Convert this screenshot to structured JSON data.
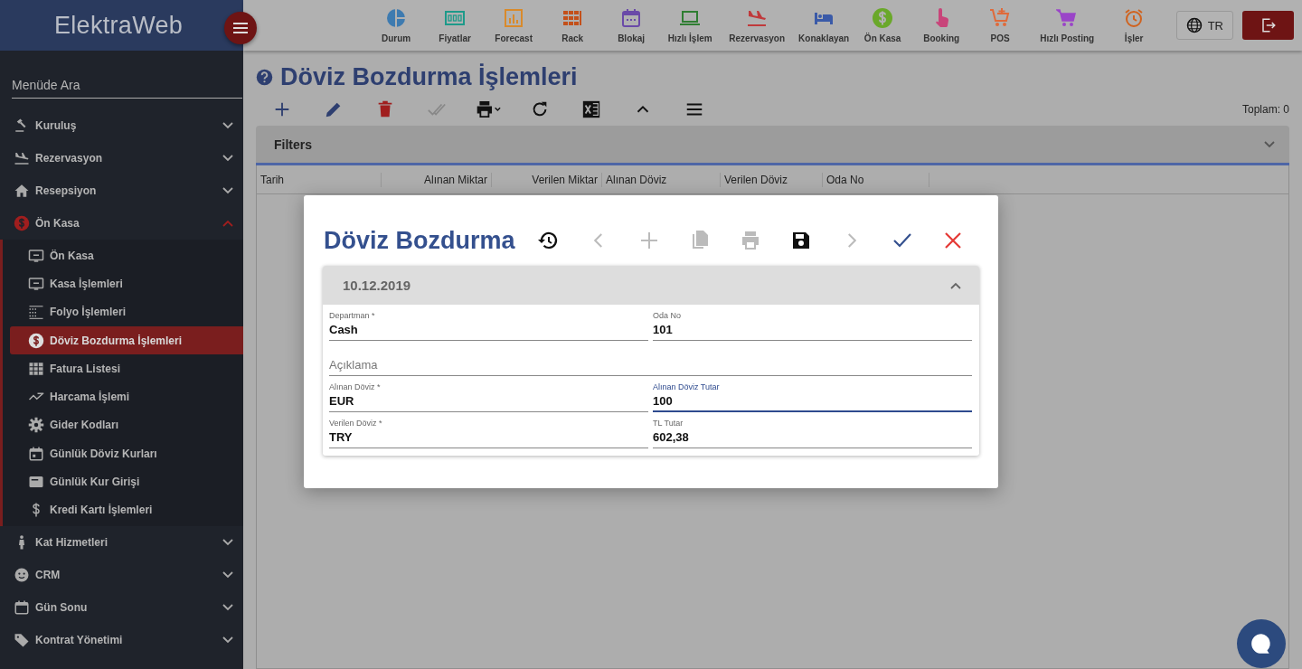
{
  "app": {
    "logo": "ElektraWeb",
    "language": "TR"
  },
  "top_nav": [
    {
      "label": "Durum",
      "color": "#3e7bb0"
    },
    {
      "label": "Fiyatlar",
      "color": "#1d9a8a"
    },
    {
      "label": "Forecast",
      "color": "#d98a2b"
    },
    {
      "label": "Rack",
      "color": "#c4501a"
    },
    {
      "label": "Blokaj",
      "color": "#6a4aa8"
    },
    {
      "label": "Hızlı İşlem",
      "color": "#2f7d32"
    },
    {
      "label": "Rezervasyon",
      "color": "#c0393b"
    },
    {
      "label": "Konaklayan",
      "color": "#3a5aa8"
    },
    {
      "label": "Ön Kasa",
      "color": "#6aa82a"
    },
    {
      "label": "Booking",
      "color": "#c8457a"
    },
    {
      "label": "POS",
      "color": "#e06a3a"
    },
    {
      "label": "Hızlı Posting",
      "color": "#9a45c8"
    },
    {
      "label": "İşler",
      "color": "#d0621e"
    }
  ],
  "sidebar": {
    "search": {
      "placeholder": "Menüde Ara"
    },
    "items": [
      {
        "label": "Kuruluş",
        "expanded": false
      },
      {
        "label": "Rezervasyon",
        "expanded": false
      },
      {
        "label": "Resepsiyon",
        "expanded": false
      },
      {
        "label": "Ön Kasa",
        "expanded": true,
        "children": [
          {
            "label": "Ön Kasa",
            "selected": false
          },
          {
            "label": "Kasa İşlemleri",
            "selected": false
          },
          {
            "label": "Folyo İşlemleri",
            "selected": false
          },
          {
            "label": "Döviz Bozdurma İşlemleri",
            "selected": true
          },
          {
            "label": "Fatura Listesi",
            "selected": false
          },
          {
            "label": "Harcama İşlemi",
            "selected": false
          },
          {
            "label": "Gider Kodları",
            "selected": false
          },
          {
            "label": "Günlük Döviz Kurları",
            "selected": false
          },
          {
            "label": "Günlük Kur Girişi",
            "selected": false
          },
          {
            "label": "Kredi Kartı İşlemleri",
            "selected": false
          }
        ]
      },
      {
        "label": "Kat Hizmetleri",
        "expanded": false
      },
      {
        "label": "CRM",
        "expanded": false
      },
      {
        "label": "Gün Sonu",
        "expanded": false
      },
      {
        "label": "Kontrat Yönetimi",
        "expanded": false
      }
    ]
  },
  "page": {
    "title": "Döviz Bozdurma İşlemleri",
    "total": "Toplam: 0",
    "filters": "Filters",
    "columns": [
      "Tarih",
      "Alınan Miktar",
      "Verilen Miktar",
      "Alınan Döviz",
      "Verilen Döviz",
      "Oda No"
    ]
  },
  "dialog": {
    "title": "Döviz Bozdurma",
    "tools": [
      {
        "disabled": false
      },
      {
        "disabled": true
      },
      {
        "disabled": true
      },
      {
        "disabled": true
      },
      {
        "disabled": true
      },
      {
        "disabled": false
      },
      {
        "disabled": true
      },
      {
        "disabled": false
      },
      {
        "disabled": false
      }
    ],
    "section": {
      "title": "10.12.2019",
      "expanded": true
    },
    "fields": [
      {
        "kind": "half",
        "label": "Departman *",
        "value": "Cash",
        "focused": false
      },
      {
        "kind": "half",
        "label": "Oda No",
        "value": "101",
        "focused": false
      },
      {
        "kind": "full",
        "placeholder": "Açıklama",
        "focused": false
      },
      {
        "kind": "half",
        "label": "Alınan Döviz *",
        "value": "EUR",
        "focused": false
      },
      {
        "kind": "half",
        "label": "Alınan Döviz Tutar",
        "value": "100",
        "focused": true
      },
      {
        "kind": "half",
        "label": "Verilen Döviz *",
        "value": "TRY",
        "focused": false
      },
      {
        "kind": "half",
        "label": "TL Tutar",
        "value": "602,38",
        "focused": false
      }
    ]
  }
}
